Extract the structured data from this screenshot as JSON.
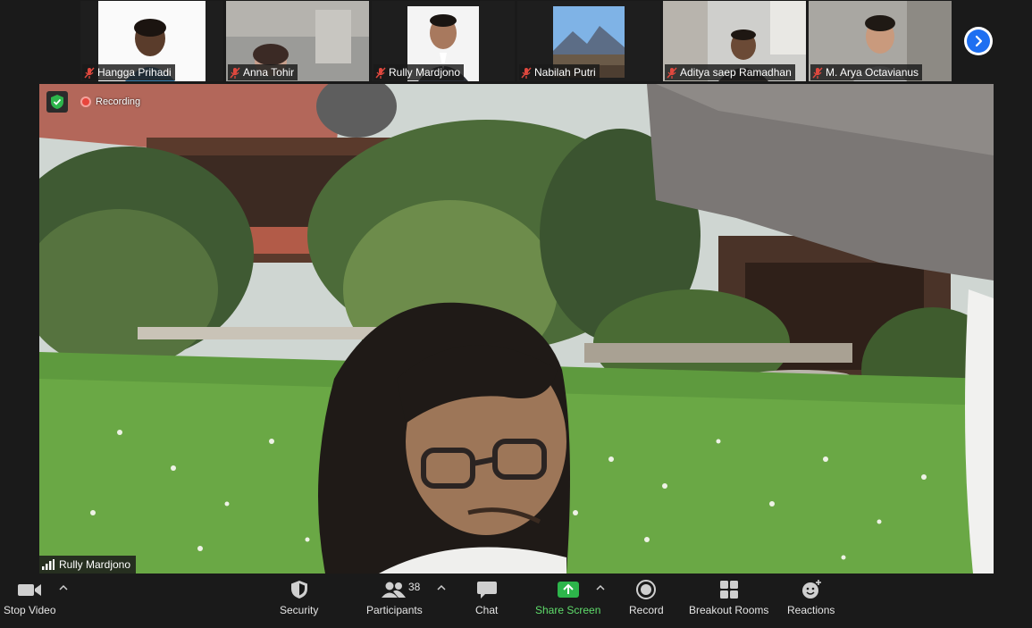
{
  "participants": [
    {
      "name": "Hangga Prihadi",
      "muted": true
    },
    {
      "name": "Anna Tohir",
      "muted": true
    },
    {
      "name": "Rully Mardjono",
      "muted": true
    },
    {
      "name": "Nabilah Putri",
      "muted": true
    },
    {
      "name": "Aditya saep Ramadhan",
      "muted": true
    },
    {
      "name": "M. Arya Octavianus",
      "muted": true
    }
  ],
  "main": {
    "recording_label": "Recording",
    "speaker_name": "Rully Mardjono"
  },
  "toolbar": {
    "stop_video": "Stop Video",
    "security": "Security",
    "participants": "Participants",
    "participants_count": "38",
    "chat": "Chat",
    "share_screen": "Share Screen",
    "record": "Record",
    "breakout_rooms": "Breakout Rooms",
    "reactions": "Reactions"
  },
  "colors": {
    "accent_blue": "#1e6ff1",
    "share_green": "#5fdc6b",
    "record_red": "#e8453c",
    "mute_red": "#e0483e",
    "bar_bg": "#1a1a1a"
  },
  "icons": [
    "mic-muted-icon",
    "chevron-right-icon",
    "shield-check-icon",
    "recording-dot-icon",
    "signal-bars-icon",
    "video-camera-icon",
    "security-shield-icon",
    "participants-icon",
    "chat-bubble-icon",
    "share-screen-icon",
    "record-icon",
    "breakout-rooms-icon",
    "reactions-icon",
    "caret-up-icon"
  ]
}
